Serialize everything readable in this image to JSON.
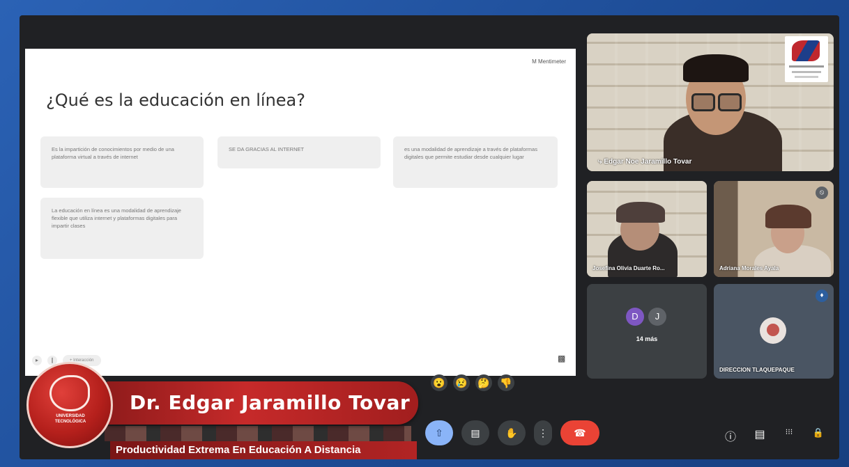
{
  "slide": {
    "brand": "M Mentimeter",
    "title": "¿Qué es la educación en línea?",
    "notes": [
      "Es la impartición de conocimientos por medio de una plataforma virtual a través de internet",
      "SE DA GRACIAS AL INTERNET",
      "es una modalidad de aprendizaje a través de plataformas digitales que permite estudiar desde cualquier lugar",
      "La educación en línea es una modalidad de aprendizaje flexible que utiliza internet y plataformas digitales para impartir clases"
    ],
    "tool_pill": "+ Interacción"
  },
  "participants": {
    "main": {
      "name": "Edgar Noe Jaramillo Tovar"
    },
    "tile2": {
      "name": "Josefina Olivia Duarte Ro..."
    },
    "tile3": {
      "name": "Adriana Morales Ayala"
    },
    "more": {
      "initials": [
        "D",
        "J"
      ],
      "label": "14 más"
    },
    "tile5": {
      "name": "DIRECCION TLAQUEPAQUE"
    }
  },
  "reactions": [
    "😮",
    "😢",
    "🤔",
    "👎"
  ],
  "controls": {
    "present": "⇧",
    "captions": "▤",
    "raise_hand": "✋",
    "more": "⋮",
    "end": "☎"
  },
  "right_controls": {
    "info": "ⓘ",
    "chat": "▤",
    "apps": "⁝⁝⁝",
    "lock": "🔒"
  },
  "overlay": {
    "name": "Dr. Edgar Jaramillo Tovar",
    "subtitle": "Productividad Extrema En Educación A Distancia",
    "logo_text": "UNIVERSIDAD TECNOLÓGICA"
  },
  "colors": {
    "accent": "#8ab4f8",
    "end_call": "#ea4335",
    "overlay_red": "#c62a2a",
    "frame_blue": "#1f4f9a"
  }
}
